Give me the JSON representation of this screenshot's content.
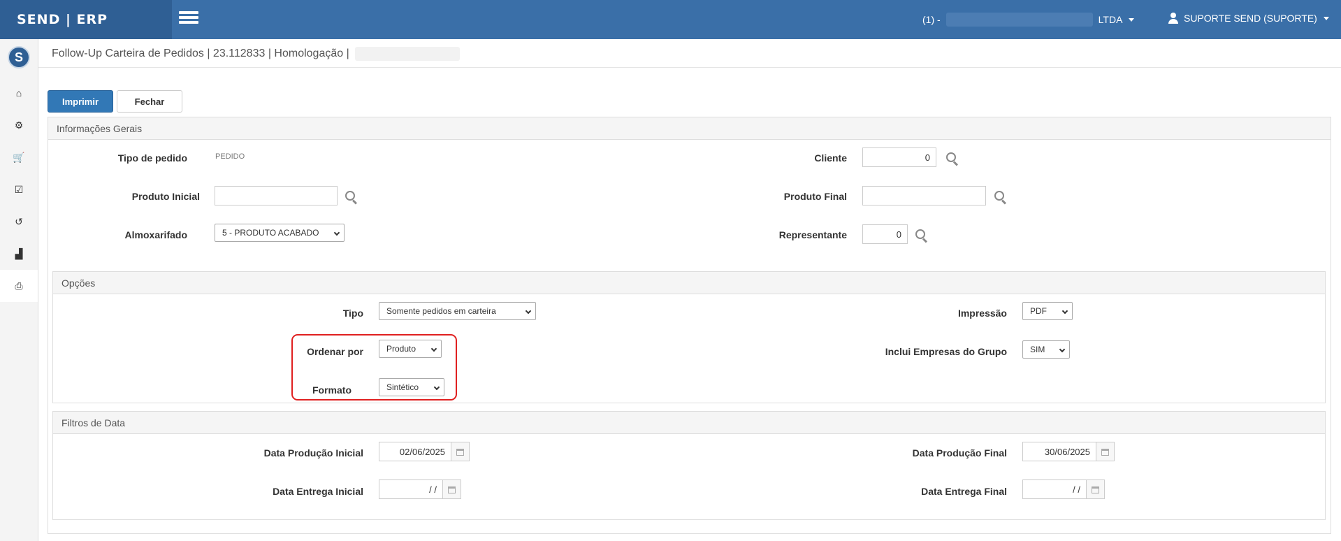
{
  "header": {
    "brand": "SEND | ERP",
    "company_prefix": "(1) -",
    "company_suffix": "LTDA",
    "user": "SUPORTE SEND (SUPORTE)"
  },
  "sidebar": {
    "logo": "S",
    "items": [
      {
        "icon": "home-icon",
        "glyph": "⌂"
      },
      {
        "icon": "gears-icon",
        "glyph": "⚙"
      },
      {
        "icon": "cart-icon",
        "glyph": "🛒"
      },
      {
        "icon": "checkbox-icon",
        "glyph": "☑"
      },
      {
        "icon": "history-icon",
        "glyph": "↺"
      },
      {
        "icon": "chart-icon",
        "glyph": "▟"
      },
      {
        "icon": "print-icon",
        "glyph": "⎙"
      }
    ]
  },
  "page": {
    "title": "Follow-Up Carteira de Pedidos | 23.112833 | Homologação |"
  },
  "toolbar": {
    "print_label": "Imprimir",
    "close_label": "Fechar"
  },
  "general": {
    "title": "Informações Gerais",
    "tipo_pedido_label": "Tipo de pedido",
    "tipo_pedido_value": "PEDIDO",
    "cliente_label": "Cliente",
    "cliente_value": "0",
    "produto_inicial_label": "Produto Inicial",
    "produto_inicial_value": "",
    "produto_final_label": "Produto Final",
    "produto_final_value": "",
    "almoxarifado_label": "Almoxarifado",
    "almoxarifado_value": "5 - PRODUTO ACABADO",
    "representante_label": "Representante",
    "representante_value": "0"
  },
  "options": {
    "title": "Opções",
    "tipo_label": "Tipo",
    "tipo_value": "Somente pedidos em carteira",
    "impressao_label": "Impressão",
    "impressao_value": "PDF",
    "ordenar_label": "Ordenar por",
    "ordenar_value": "Produto",
    "empresas_label": "Inclui Empresas do Grupo",
    "empresas_value": "SIM",
    "formato_label": "Formato",
    "formato_value": "Sintético"
  },
  "dates": {
    "title": "Filtros de Data",
    "prod_inicial_label": "Data Produção Inicial",
    "prod_inicial_value": "02/06/2025",
    "prod_final_label": "Data Produção Final",
    "prod_final_value": "30/06/2025",
    "entrega_inicial_label": "Data Entrega Inicial",
    "entrega_inicial_value": "/ /",
    "entrega_final_label": "Data Entrega Final",
    "entrega_final_value": "/ /"
  },
  "colors": {
    "topbar": "#3a6fa8",
    "primary_button": "#3278b6",
    "highlight": "#e02020"
  }
}
